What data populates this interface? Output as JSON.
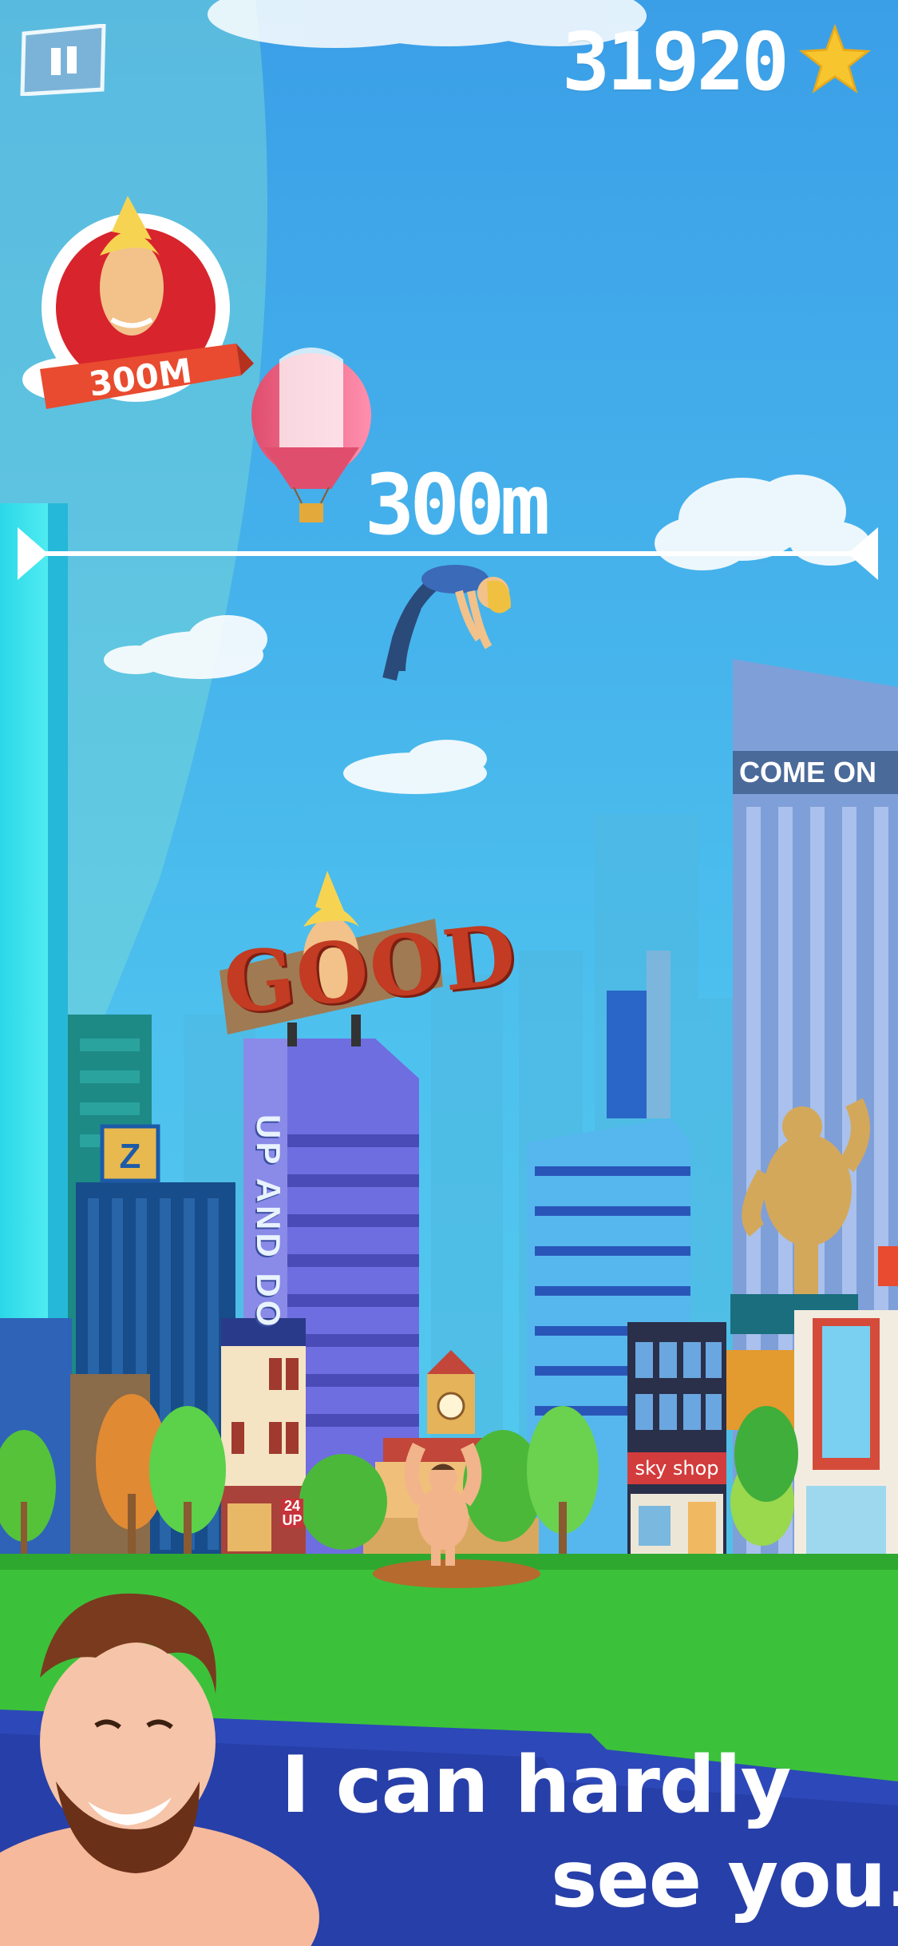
{
  "hud": {
    "score": "31920",
    "pause_icon": "pause-icon",
    "star_icon": "star-icon"
  },
  "target": {
    "badge_label": "300M",
    "height_label": "300m"
  },
  "signs": {
    "good": "GOOD",
    "come_on": "COME ON",
    "up_and_down": "UP AND DO",
    "sky_shop": "sky shop",
    "hours_24": "24",
    "hours_up": "UP"
  },
  "dialog": {
    "line1": "I can hardly",
    "line2": "see you."
  },
  "colors": {
    "sky_top": "#3b9fe8",
    "sky_bottom": "#5ad0ef",
    "grass": "#3bc23a",
    "dialog_band": "#2d48b8",
    "badge_red": "#d8242c",
    "star": "#f7c62f"
  }
}
